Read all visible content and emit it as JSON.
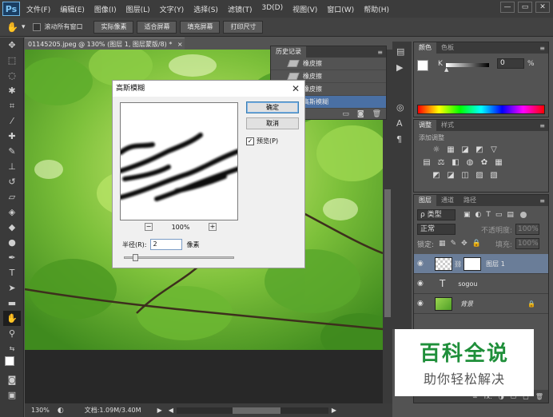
{
  "app": {
    "logo": "Ps"
  },
  "menu": [
    "文件(F)",
    "编辑(E)",
    "图像(I)",
    "图层(L)",
    "文字(Y)",
    "选择(S)",
    "滤镜(T)",
    "3D(D)",
    "视图(V)",
    "窗口(W)",
    "帮助(H)"
  ],
  "window_controls": {
    "minimize": "—",
    "restore": "▭",
    "close": "✕"
  },
  "options_bar": {
    "scroll_all_label": "滚动所有窗口",
    "buttons": [
      "实际像素",
      "适合屏幕",
      "填充屏幕",
      "打印尺寸"
    ]
  },
  "document": {
    "tab_title": "01145205.jpeg @ 130% (图层 1, 图层蒙版/8) *",
    "tab_close": "×",
    "zoom": "130%",
    "doc_info": "文档:1.09M/3.40M"
  },
  "history_panel": {
    "tab": "历史记录",
    "items": [
      {
        "label": "橡皮擦",
        "selected": false
      },
      {
        "label": "橡皮擦",
        "selected": false
      },
      {
        "label": "橡皮擦",
        "selected": false
      },
      {
        "label": "高斯模糊",
        "selected": true
      }
    ]
  },
  "color_panel": {
    "tabs": [
      "颜色",
      "色板"
    ],
    "channel_label": "K",
    "value": "0",
    "unit": "%"
  },
  "adjustments_panel": {
    "tabs": [
      "调整",
      "样式"
    ],
    "add_label": "添加调整",
    "row1": [
      "☼",
      "▦",
      "◪",
      "◩",
      "▽"
    ],
    "row2": [
      "▤",
      "⚖",
      "◧",
      "◍",
      "✿",
      "▦"
    ],
    "row3": [
      "◩",
      "◪",
      "◫",
      "▨",
      "▧"
    ]
  },
  "layers_panel": {
    "tabs": [
      "图层",
      "通道",
      "路径"
    ],
    "filter_label": "ρ 类型",
    "blend_mode": "正常",
    "opacity_label": "不透明度:",
    "opacity_value": "100%",
    "lock_label": "锁定:",
    "fill_label": "填充:",
    "fill_value": "100%",
    "layers": [
      {
        "name": "图层 1",
        "kind": "mask",
        "selected": true
      },
      {
        "name": "sogou",
        "kind": "text",
        "selected": false
      },
      {
        "name": "背景",
        "kind": "image",
        "selected": false,
        "locked": true
      }
    ],
    "footer_icons": [
      "∞",
      "fx.",
      "◑",
      "▭",
      "▢",
      "🗑"
    ]
  },
  "dialog": {
    "title": "高斯模糊",
    "ok_label": "确定",
    "cancel_label": "取消",
    "preview_label": "预览(P)",
    "preview_checked": true,
    "zoom_minus": "−",
    "zoom_value": "100%",
    "zoom_plus": "+",
    "radius_label": "半径(R):",
    "radius_value": "2",
    "radius_unit": "像素",
    "slider_level": 0.08
  },
  "watermark": {
    "title": "百科全说",
    "subtitle": "助你轻松解决"
  },
  "colors": {
    "accent_select": "#4a70a4",
    "brand_green": "#1f8f3a"
  }
}
